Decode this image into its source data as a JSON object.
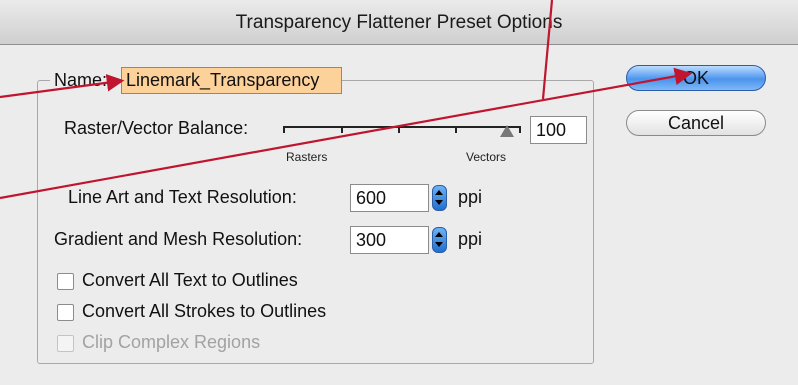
{
  "dialog": {
    "title": "Transparency Flattener Preset Options",
    "name_label": "Name:",
    "name_value": "Linemark_Transparency",
    "raster_vector_label": "Raster/Vector Balance:",
    "raster_vector_value": "100",
    "rasters_label": "Rasters",
    "vectors_label": "Vectors",
    "line_art_label": "Line Art and Text Resolution:",
    "line_art_value": "600",
    "line_art_unit": "ppi",
    "gradient_label": "Gradient and Mesh Resolution:",
    "gradient_value": "300",
    "gradient_unit": "ppi",
    "checkboxes": [
      {
        "label": "Convert All Text to Outlines",
        "checked": false,
        "enabled": true
      },
      {
        "label": "Convert All Strokes to Outlines",
        "checked": false,
        "enabled": true
      },
      {
        "label": "Clip Complex Regions",
        "checked": false,
        "enabled": false
      }
    ],
    "ok_label": "OK",
    "cancel_label": "Cancel"
  },
  "colors": {
    "name_field_highlight": "#fdd19a",
    "annotation_arrow": "#c0152f",
    "default_button": "#4a94ec"
  },
  "icons": [
    "stepper-icon",
    "slider-thumb-icon",
    "annotation-arrow-icon"
  ]
}
